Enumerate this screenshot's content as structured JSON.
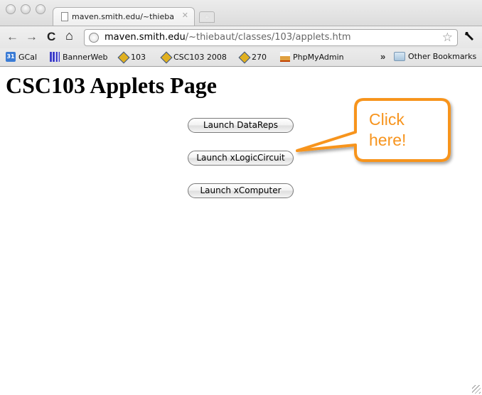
{
  "browser": {
    "tab": {
      "title": "maven.smith.edu/~thiebaut/"
    },
    "toolbar": {
      "back_icon": "←",
      "forward_icon": "→",
      "reload_icon": "C",
      "home_icon": "⌂",
      "url_host": "maven.smith.edu",
      "url_path": "/~thiebaut/classes/103/applets.htm",
      "star_icon": "☆",
      "wrench_icon": "🔧"
    },
    "bookmarks": {
      "items": [
        {
          "label": "GCal",
          "icon": "calendar-icon",
          "icon_text": "31"
        },
        {
          "label": "BannerWeb",
          "icon": "bannerweb-icon"
        },
        {
          "label": "103",
          "icon": "diamond-icon"
        },
        {
          "label": "CSC103 2008",
          "icon": "diamond-icon"
        },
        {
          "label": "270",
          "icon": "diamond-icon"
        },
        {
          "label": "PhpMyAdmin",
          "icon": "phpmyadmin-icon"
        }
      ],
      "overflow": "»",
      "other": "Other Bookmarks"
    }
  },
  "page": {
    "title": "CSC103 Applets Page",
    "buttons": [
      "Launch DataReps",
      "Launch xLogicCircuit",
      "Launch xComputer"
    ],
    "callout": {
      "line1": "Click",
      "line2": "here!",
      "color": "#f7941d"
    }
  }
}
